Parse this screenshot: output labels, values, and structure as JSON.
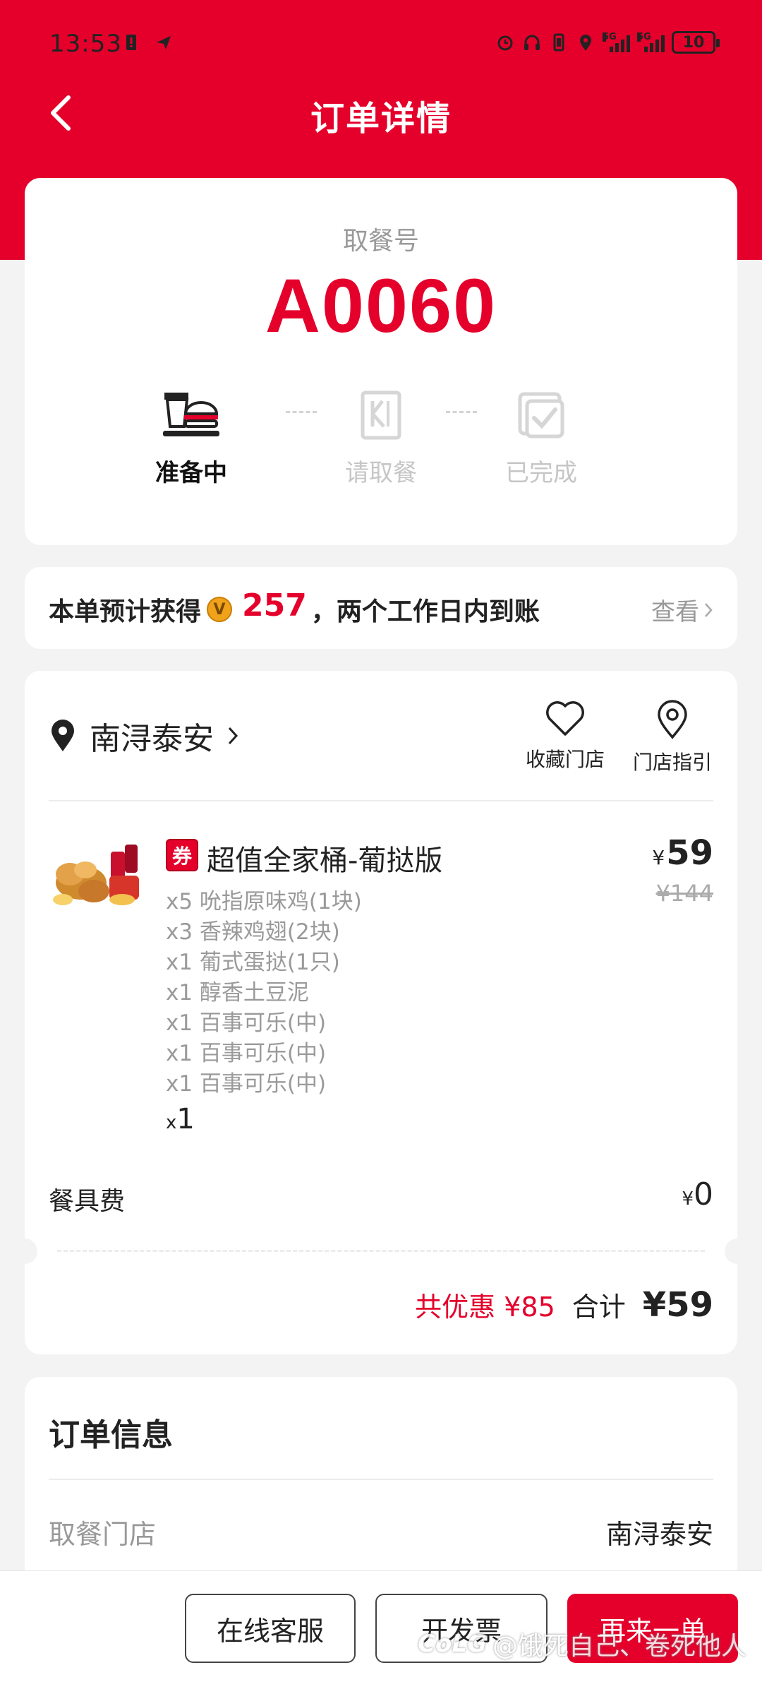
{
  "status_bar": {
    "time": "13:53",
    "battery": "10",
    "signal_label_1": "5G",
    "signal_label_2": "5G"
  },
  "nav": {
    "title": "订单详情"
  },
  "pickup": {
    "label": "取餐号",
    "number": "A0060",
    "steps": [
      {
        "label": "准备中",
        "icon": "burger-tray-icon",
        "state": "active"
      },
      {
        "label": "请取餐",
        "icon": "kfc-bag-icon",
        "state": "inactive"
      },
      {
        "label": "已完成",
        "icon": "check-box-icon",
        "state": "inactive"
      }
    ]
  },
  "points": {
    "prefix": "本单预计获得",
    "coin_letter": "V",
    "value": "257",
    "suffix": "，两个工作日内到账",
    "view": "查看"
  },
  "store": {
    "name": "南浔泰安",
    "favorite_label": "收藏门店",
    "directions_label": "门店指引"
  },
  "product": {
    "coupon_tag": "券",
    "name": "超值全家桶-葡挞版",
    "yen_symbol": "¥",
    "price_now": "59",
    "price_old": "¥144",
    "items": [
      "x5 吮指原味鸡(1块)",
      "x3 香辣鸡翅(2块)",
      "x1 葡式蛋挞(1只)",
      "x1 醇香土豆泥",
      "x1 百事可乐(中)",
      "x1 百事可乐(中)",
      "x1 百事可乐(中)"
    ],
    "qty_prefix": "x",
    "qty": "1"
  },
  "fees": {
    "tableware_label": "餐具费",
    "tableware_value": "0"
  },
  "totals": {
    "discount": "共优惠 ¥85",
    "total_label": "合计",
    "total_value": "¥59"
  },
  "order_info": {
    "title": "订单信息",
    "store_label": "取餐门店",
    "store_value": "南浔泰安"
  },
  "actions": {
    "service": "在线客服",
    "invoice": "开发票",
    "reorder": "再来一单"
  },
  "watermark": {
    "logo": "CoLG",
    "text": "@饿死自己、卷死他人"
  },
  "colors": {
    "brand_red": "#e4002b",
    "background": "#f3f3f3"
  }
}
